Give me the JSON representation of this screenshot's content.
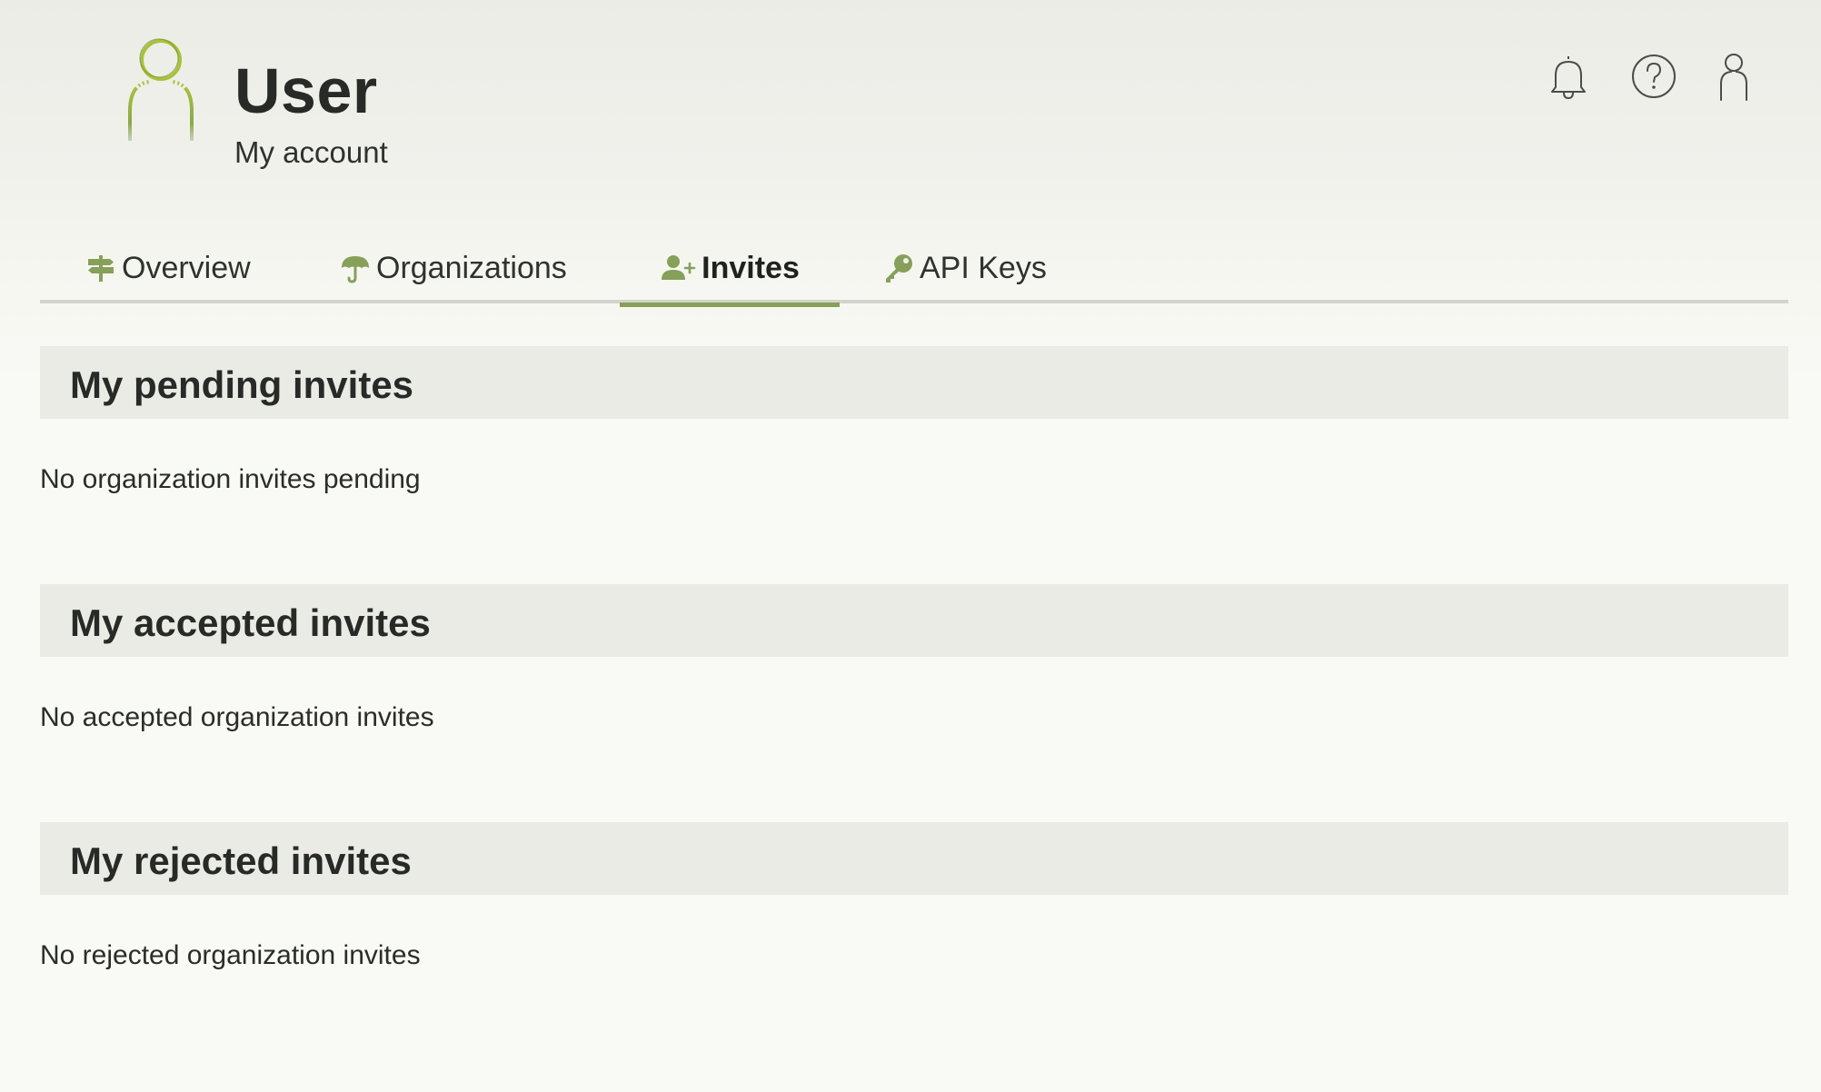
{
  "header": {
    "title": "User",
    "subtitle": "My account"
  },
  "top_icons": [
    "bell-icon",
    "help-icon",
    "account-icon"
  ],
  "tabs": [
    {
      "label": "Overview",
      "icon": "signpost-icon",
      "active": false
    },
    {
      "label": "Organizations",
      "icon": "umbrella-icon",
      "active": false
    },
    {
      "label": "Invites",
      "icon": "user-plus-icon",
      "active": true
    },
    {
      "label": "API Keys",
      "icon": "key-icon",
      "active": false
    }
  ],
  "sections": [
    {
      "title": "My pending invites",
      "empty_text": "No organization invites pending"
    },
    {
      "title": "My accepted invites",
      "empty_text": "No accepted organization invites"
    },
    {
      "title": "My rejected invites",
      "empty_text": "No rejected organization invites"
    }
  ],
  "colors": {
    "accent": "#86a05a",
    "logo_green": "#a8c23c",
    "section_header_bg": "#ebebe6",
    "page_bg": "#f9f9f5"
  }
}
